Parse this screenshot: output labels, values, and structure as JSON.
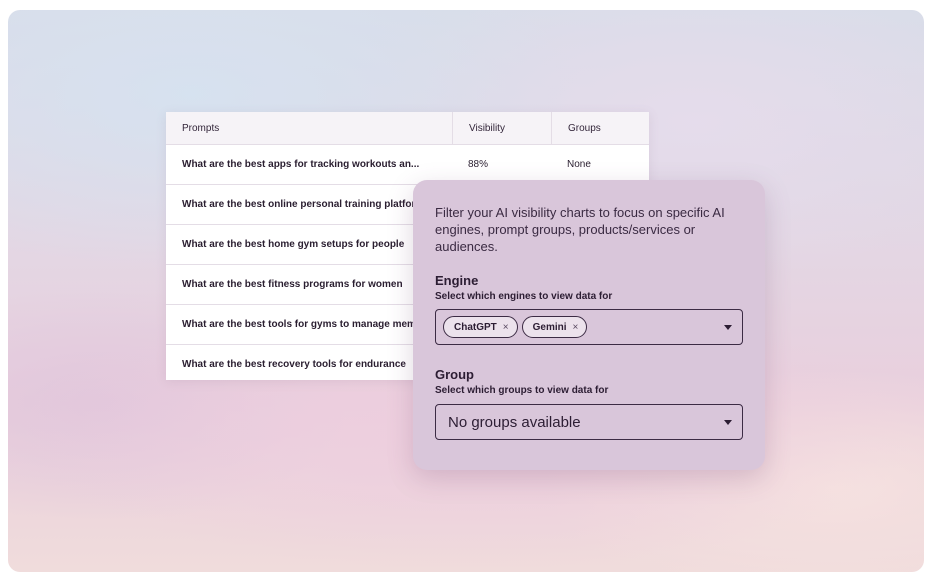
{
  "table": {
    "headers": {
      "prompts": "Prompts",
      "visibility": "Visibility",
      "groups": "Groups"
    },
    "rows": [
      {
        "prompt": "What are the best apps for tracking workouts an...",
        "visibility": "88%",
        "groups": "None"
      },
      {
        "prompt": "What are the best online personal training platforms",
        "visibility": "",
        "groups": ""
      },
      {
        "prompt": "What are the best home gym setups for people",
        "visibility": "",
        "groups": ""
      },
      {
        "prompt": "What are the best fitness programs for women",
        "visibility": "",
        "groups": ""
      },
      {
        "prompt": "What are the best tools for gyms to manage members",
        "visibility": "",
        "groups": ""
      },
      {
        "prompt": "What are the best recovery tools for endurance",
        "visibility": "",
        "groups": ""
      }
    ]
  },
  "filter_panel": {
    "description": "Filter your AI visibility charts to focus on specific AI engines, prompt groups, products/services or audiences.",
    "engine": {
      "title": "Engine",
      "subtitle": "Select which engines to view data for",
      "chips": [
        {
          "label": "ChatGPT",
          "remove_icon": "×"
        },
        {
          "label": "Gemini",
          "remove_icon": "×"
        }
      ]
    },
    "group": {
      "title": "Group",
      "subtitle": "Select which groups to view data for",
      "selected": "No groups available"
    }
  },
  "colors": {
    "panel_bg": "#d9c6da",
    "text_dark": "#2c1d33",
    "table_header_bg": "#f6f3f7"
  }
}
